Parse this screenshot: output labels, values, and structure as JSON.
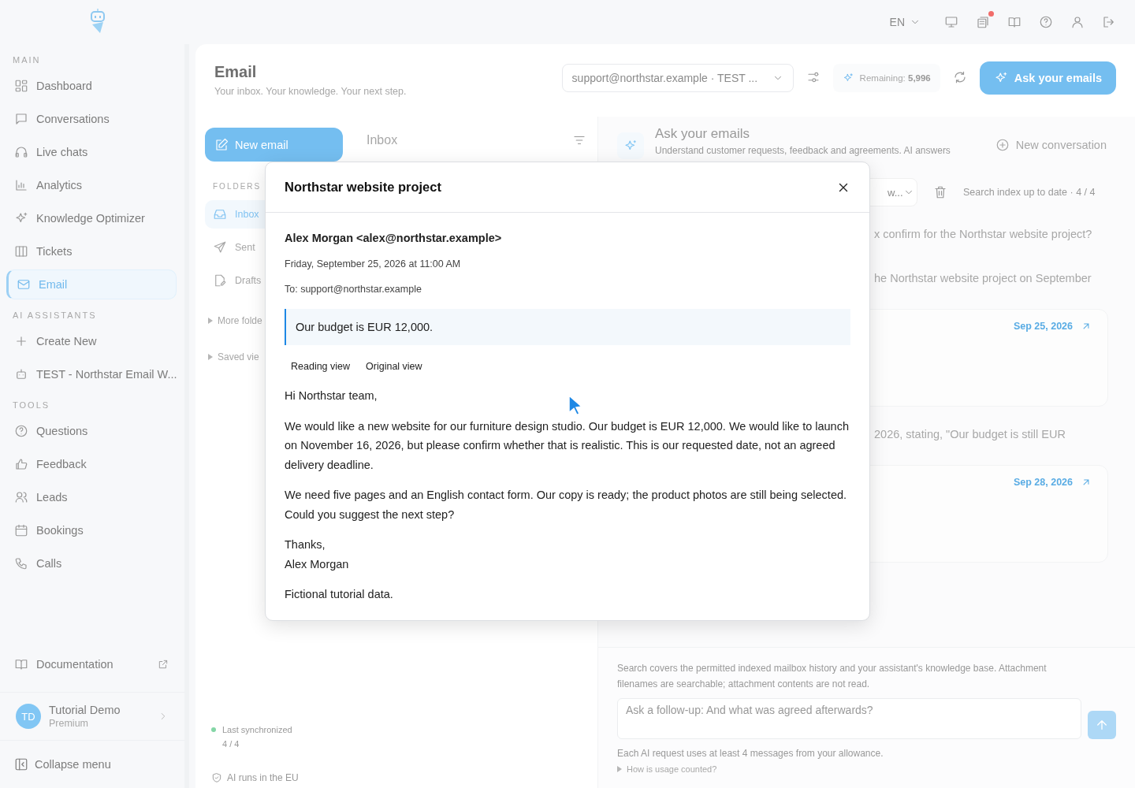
{
  "top_bar": {
    "language": "EN",
    "alert": true
  },
  "sidebar": {
    "sections": [
      {
        "heading": "MAIN",
        "items": [
          {
            "label": "Dashboard",
            "selected": false
          },
          {
            "label": "Conversations",
            "selected": false
          },
          {
            "label": "Live chats",
            "selected": false
          },
          {
            "label": "Analytics",
            "selected": false
          },
          {
            "label": "Knowledge Optimizer",
            "selected": false
          },
          {
            "label": "Tickets",
            "selected": false
          },
          {
            "label": "Email",
            "selected": true
          }
        ]
      },
      {
        "heading": "AI ASSISTANTS",
        "items": [
          {
            "label": "Create New",
            "selected": false
          },
          {
            "label": "TEST - Northstar Email W...",
            "selected": false
          }
        ]
      },
      {
        "heading": "TOOLS",
        "items": [
          {
            "label": "Questions",
            "selected": false
          },
          {
            "label": "Feedback",
            "selected": false
          },
          {
            "label": "Leads",
            "selected": false
          },
          {
            "label": "Bookings",
            "selected": false
          },
          {
            "label": "Calls",
            "selected": false
          }
        ]
      }
    ],
    "documentation": "Documentation",
    "profile": {
      "initials": "TD",
      "name": "Tutorial Demo",
      "plan": "Premium"
    },
    "collapse": "Collapse menu"
  },
  "header": {
    "title": "Email",
    "subtitle": "Your inbox. Your knowledge. Your next step.",
    "account": "support@northstar.example · TEST ...",
    "remaining_label": "Remaining:",
    "remaining_value": "5,996",
    "ask_button": "Ask your emails"
  },
  "mail_list": {
    "new_email": "New email",
    "heading": "Inbox",
    "folders_heading": "FOLDERS",
    "folders": [
      {
        "label": "Inbox",
        "selected": true
      },
      {
        "label": "Sent",
        "selected": false
      },
      {
        "label": "Drafts",
        "selected": false
      }
    ],
    "groups": [
      "More folde",
      "Saved vie"
    ],
    "sync_label": "Last synchronized",
    "sync_count": "4 / 4",
    "eu_note": "AI runs in the EU"
  },
  "ask_panel": {
    "title": "Ask your emails",
    "subtitle": "Understand customer requests, feedback and agreements. AI answers",
    "new_conversation": "New conversation",
    "thread": "w...",
    "index_status": "Search index up to date · 4 / 4",
    "messages": [
      {
        "kind": "text",
        "text": "x confirm for the Northstar website project?"
      },
      {
        "kind": "text",
        "text": "he Northstar website project on September"
      },
      {
        "kind": "source",
        "date": "Sep 25, 2026"
      },
      {
        "kind": "text",
        "text": "2026, stating, \"Our budget is still EUR"
      },
      {
        "kind": "source",
        "date": "Sep 28, 2026"
      }
    ],
    "composer": {
      "note": "Search covers the permitted indexed mailbox history and your assistant's knowledge base. Attachment filenames are searchable; attachment contents are not read.",
      "placeholder": "Ask a follow-up: And what was agreed afterwards?",
      "allowance": "Each AI request uses at least 4 messages from your allowance.",
      "usage_link": "How is usage counted?"
    }
  },
  "modal": {
    "title": "Northstar website project",
    "sender": "Alex Morgan <alex@northstar.example>",
    "date": "Friday, September 25, 2026 at 11:00 AM",
    "to": "To: support@northstar.example",
    "quote": "Our budget is EUR 12,000.",
    "views": [
      "Reading view",
      "Original view"
    ],
    "paragraphs": [
      [
        "Hi Northstar team,"
      ],
      [
        "We would like a new website for our furniture design studio. Our budget is EUR 12,000. We would like to launch on November 16, 2026, but please confirm whether that is realistic. This is our requested date, not an agreed delivery deadline."
      ],
      [
        "We need five pages and an English contact form. Our copy is ready; the product photos are still being selected. Could you suggest the next step?"
      ],
      [
        "Thanks,",
        "Alex Morgan"
      ],
      [
        "Fictional tutorial data."
      ]
    ]
  }
}
